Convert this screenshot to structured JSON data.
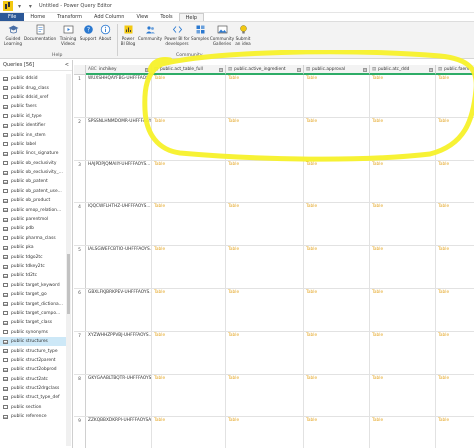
{
  "window": {
    "title": "Untitled - Power Query Editor",
    "quick_access": "▾ ▾"
  },
  "tabs": [
    {
      "label": "File"
    },
    {
      "label": "Home"
    },
    {
      "label": "Transform"
    },
    {
      "label": "Add Column"
    },
    {
      "label": "View"
    },
    {
      "label": "Tools"
    },
    {
      "label": "Help"
    }
  ],
  "ribbon": {
    "help_buttons": [
      {
        "label": "Guided\nLearning"
      },
      {
        "label": "Documentation"
      },
      {
        "label": "Training\nVideos"
      },
      {
        "label": "Support"
      },
      {
        "label": "About"
      }
    ],
    "community_buttons": [
      {
        "label": "Power\nBI Blog"
      },
      {
        "label": "Community"
      },
      {
        "label": "Power BI for\ndevelopers"
      },
      {
        "label": "Samples"
      },
      {
        "label": "Community\nGalleries"
      },
      {
        "label": "Submit\nan idea"
      }
    ],
    "group_help": "Help",
    "group_community": "Community"
  },
  "queries": {
    "header": "Queries [56]",
    "collapse": "<",
    "items": [
      "public ddsid",
      "public drug_class",
      "public ddsid_xref",
      "public faers",
      "public id_type",
      "public identifier",
      "public inn_stem",
      "public label",
      "public lincs_signature",
      "public ob_exclusivity",
      "public ob_exclusivity_...",
      "public ob_patent",
      "public ob_patent_use...",
      "public ob_product",
      "public omop_relation...",
      "public parentmol",
      "public pdb",
      "public pharma_class",
      "public pka",
      "public tdgo2tc",
      "public tdkey2tc",
      "public td2tc",
      "public target_keyword",
      "public target_go",
      "public target_dictiona...",
      "public target_compo...",
      "public target_class",
      "public synonyms",
      "public structures",
      "public structure_type",
      "public struct2parent",
      "public struct2obprod",
      "public struct2atc",
      "public struct2drgclass",
      "public struct_type_def",
      "public section",
      "public reference"
    ],
    "selected_index": 28
  },
  "grid": {
    "columns": [
      {
        "label": "inchikey",
        "type": "ABC"
      },
      {
        "label": "public.act_table_full",
        "type": "▤"
      },
      {
        "label": "public.active_ingredient",
        "type": "▤"
      },
      {
        "label": "public.approval",
        "type": "▤"
      },
      {
        "label": "public.atc_ddd",
        "type": "▤"
      },
      {
        "label": "public.faers",
        "type": "▤"
      }
    ],
    "rows": [
      {
        "n": "1",
        "key": "WUXSHHQAYFBG-UHFFFAOY..."
      },
      {
        "n": "2",
        "key": "SPSSNLHNMDOMR-UHFFFAOY..."
      },
      {
        "n": "3",
        "key": "HAJPDPJQMAIIY-UHFFFAOYS..."
      },
      {
        "n": "4",
        "key": "IQQCWFLHTHZ-UHFFFAOYS..."
      },
      {
        "n": "5",
        "key": "IALSGWEFCBTIO-UHFFFAOYS..."
      },
      {
        "n": "6",
        "key": "GBXLFKJBRKPEV-UHFFFAOYS..."
      },
      {
        "n": "7",
        "key": "XYZWHHZPPVBJ-UHFFFAOYS..."
      },
      {
        "n": "8",
        "key": "GKYGAABLTBQTR-UHFFFAOYS..."
      },
      {
        "n": "9",
        "key": "ZZKQBBXDKRPI-UHFFFAOYSA-N"
      }
    ],
    "cell_value": "Table"
  },
  "colors": {
    "table_link": "#e4a521",
    "header_accent": "#2eac67",
    "highlight": "#f7f12a",
    "file_tab": "#2b5797"
  }
}
